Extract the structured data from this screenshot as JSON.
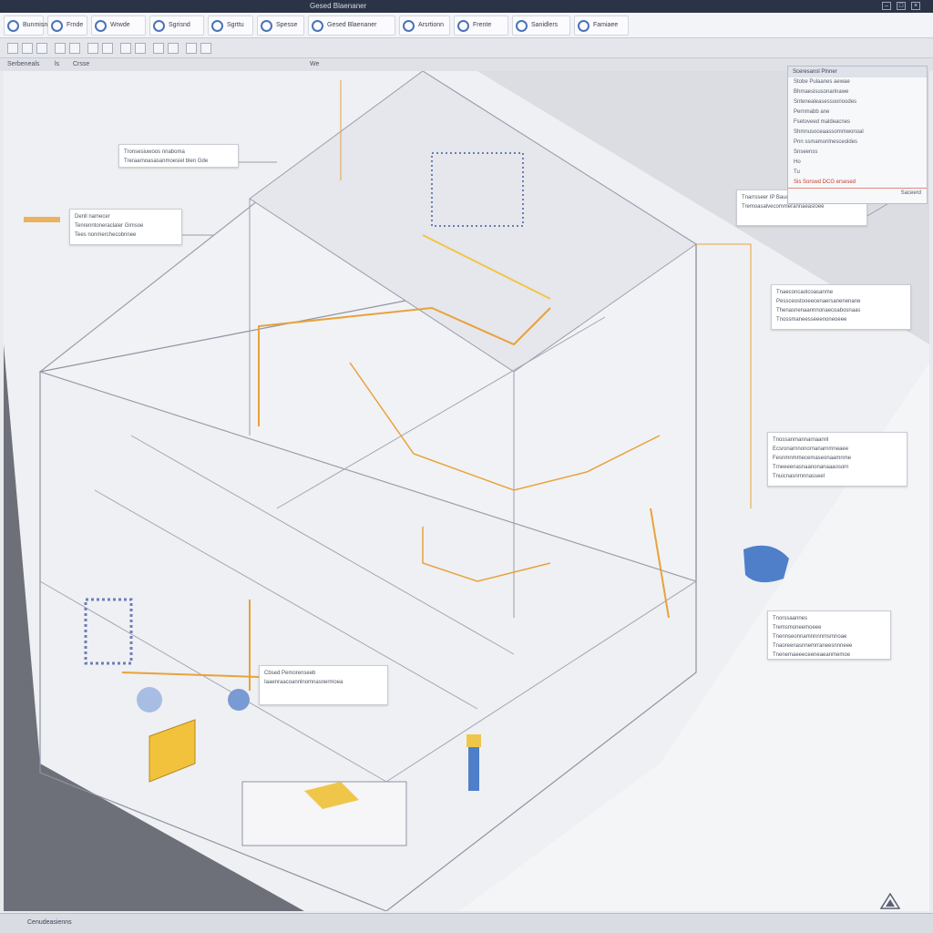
{
  "window": {
    "title": "Gesed Blaenaner",
    "controls": [
      "–",
      "□",
      "×"
    ]
  },
  "ribbon": {
    "buttons": [
      {
        "label": "Bunmisnts"
      },
      {
        "label": "Frnde"
      },
      {
        "label": "Wrwde"
      },
      {
        "label": "Sgrisnd"
      },
      {
        "label": "Sgrttu"
      },
      {
        "label": "Spesse"
      },
      {
        "label": "Arsrtionn"
      },
      {
        "label": "Frente"
      },
      {
        "label": "Sanidlers"
      },
      {
        "label": "Famiaee"
      }
    ],
    "search_label": "Gesed Blaenaner"
  },
  "view_tabs": [
    "Serbeneals",
    "ls",
    "Crsse",
    "We"
  ],
  "properties_panel": {
    "header": "Sceresansl Plnner",
    "rows": [
      "Stobe Pulaanes aewae",
      "Bhmaesisusonarinawe",
      "Sntenealeasessoorioodes",
      "Pernmabb ane",
      "Fsetoveed maldeacnes",
      "Shmnusoceaassommwonoal",
      "Pnn ssmamonlnesceoldes",
      "Snseenss",
      "Ho",
      "Tu",
      "Sis Sorswd DCG ersesed"
    ],
    "highlight_index": 10,
    "footer": "Saceerd"
  },
  "callouts": [
    {
      "lines": [
        "Tronsesiuwoos nnaboma",
        "Treraarnoasasanmoesiel blen Gde"
      ]
    },
    {
      "lines": [
        "Denll namecer",
        "Tenrenntoneraclaler   Gimsoe",
        "Tees nonmerchecobnnee"
      ]
    },
    {
      "lines": [
        "Tnarrsseer IP Bauo ersse",
        "Tremoasalvecommerannaeasloee"
      ]
    },
    {
      "lines": [
        "Tnaeconcaolcoasanme",
        "Pessceostooeecenaersanenenane",
        "Thenasnenaannnonaecoabosnaas",
        "Tnossmaneesseeenoneoeee"
      ]
    },
    {
      "lines": [
        "Tnossanmannarnaannl",
        "Ecsronarnnonornanarnmneaee",
        "Fesnmnmmecemaseonaamnme",
        "Trneeeenasnaanonanaaaosorn",
        "Tnuicnasnrnnnasseel"
      ]
    },
    {
      "lines": [
        "Tnorssaannes",
        "Tremsmoneemoeee",
        "Tnennseonnamnnnnmsmnoae",
        "Tnaoreenasnnemrraneesnnneee",
        "Tnenemaeeeceeneaeanmemoe"
      ]
    },
    {
      "lines": [
        "Cbsed Pemorenseeb",
        "Iaaenraacoannlnomnasnermoea"
      ]
    }
  ],
  "status": {
    "text": "Cenudeasienns",
    "logo_name": "triangle-logo-icon"
  },
  "colors": {
    "pipe_orange": "#e8a23a",
    "pipe_yellow": "#f0c64a",
    "equipment_blue": "#4f7fc9",
    "wireframe": "#8e93a3",
    "accent_red": "#c23b2a"
  }
}
